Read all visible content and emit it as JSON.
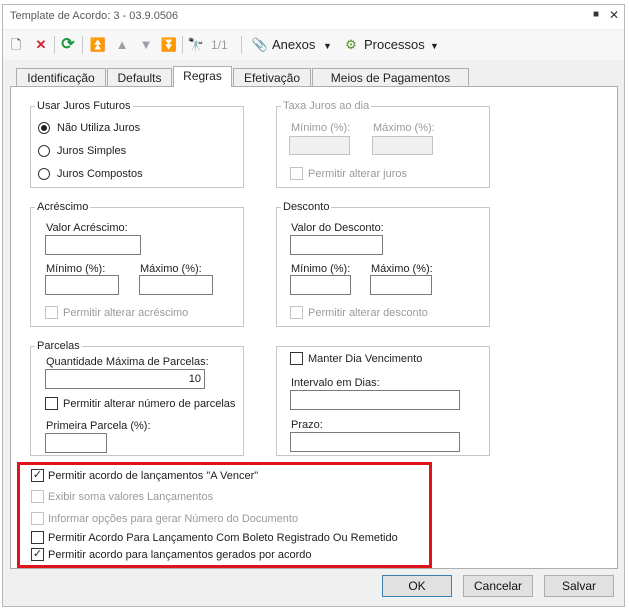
{
  "window": {
    "title": "Template de Acordo: 3 - 03.9.0506",
    "min_glyph": "■",
    "close_glyph": "✕"
  },
  "toolbar": {
    "new_icon": "🗋",
    "delete_icon": "✕",
    "refresh_icon": "⟳",
    "first_icon": "⏫",
    "prev_icon": "▲",
    "next_icon": "▼",
    "last_icon": "⏬",
    "find_icon": "🔭",
    "record_position": "1/1",
    "anexos_icon": "📎",
    "anexos_label": "Anexos",
    "processos_icon": "⚙",
    "processos_label": "Processos",
    "dropdown_glyph": "▼"
  },
  "tabs": [
    {
      "label": "Identificação"
    },
    {
      "label": "Defaults"
    },
    {
      "label": "Regras"
    },
    {
      "label": "Efetivação"
    },
    {
      "label": "Meios de Pagamentos"
    }
  ],
  "juros_futuros": {
    "legend": "Usar Juros Futuros",
    "options": [
      {
        "label": "Não Utiliza Juros",
        "selected": true
      },
      {
        "label": "Juros Simples",
        "selected": false
      },
      {
        "label": "Juros Compostos",
        "selected": false
      }
    ]
  },
  "taxa_juros": {
    "legend": "Taxa Juros ao dia",
    "min_label": "Mínimo (%):",
    "min_value": "",
    "max_label": "Máximo (%):",
    "max_value": "",
    "allow_label": "Permitir alterar juros",
    "enabled": false
  },
  "acrescimo": {
    "legend": "Acréscimo",
    "valor_label": "Valor Acréscimo:",
    "valor_value": "",
    "min_label": "Mínimo (%):",
    "min_value": "",
    "max_label": "Máximo (%):",
    "max_value": "",
    "allow_label": "Permitir alterar acréscimo"
  },
  "desconto": {
    "legend": "Desconto",
    "valor_label": "Valor do Desconto:",
    "valor_value": "",
    "min_label": "Mínimo (%):",
    "min_value": "",
    "max_label": "Máximo (%):",
    "max_value": "",
    "allow_label": "Permitir alterar desconto"
  },
  "parcelas": {
    "legend": "Parcelas",
    "max_label": "Quantidade Máxima de Parcelas:",
    "max_value": "10",
    "allow_label": "Permitir alterar número de parcelas",
    "primeira_label": "Primeira Parcela (%):",
    "primeira_value": ""
  },
  "vencimento": {
    "manter_label": "Manter Dia Vencimento",
    "intervalo_label": "Intervalo em Dias:",
    "intervalo_value": "",
    "prazo_label": "Prazo:",
    "prazo_value": ""
  },
  "options": [
    {
      "label": "Permitir acordo de lançamentos \"A Vencer\"",
      "checked": true,
      "enabled": true
    },
    {
      "label": "Exibir soma valores Lançamentos",
      "checked": false,
      "enabled": false
    },
    {
      "label": "Informar opções para gerar Número do Documento",
      "checked": false,
      "enabled": false
    },
    {
      "label": "Permitir Acordo Para Lançamento Com Boleto Registrado Ou Remetido",
      "checked": false,
      "enabled": true
    },
    {
      "label": "Permitir acordo para lançamentos gerados por acordo",
      "checked": true,
      "enabled": true
    }
  ],
  "buttons": {
    "ok": "OK",
    "cancel": "Cancelar",
    "save": "Salvar"
  },
  "colors": {
    "highlight_box": "#e0121a",
    "refresh_icon": "#1c9a3c",
    "delete_icon": "#d2232a"
  }
}
